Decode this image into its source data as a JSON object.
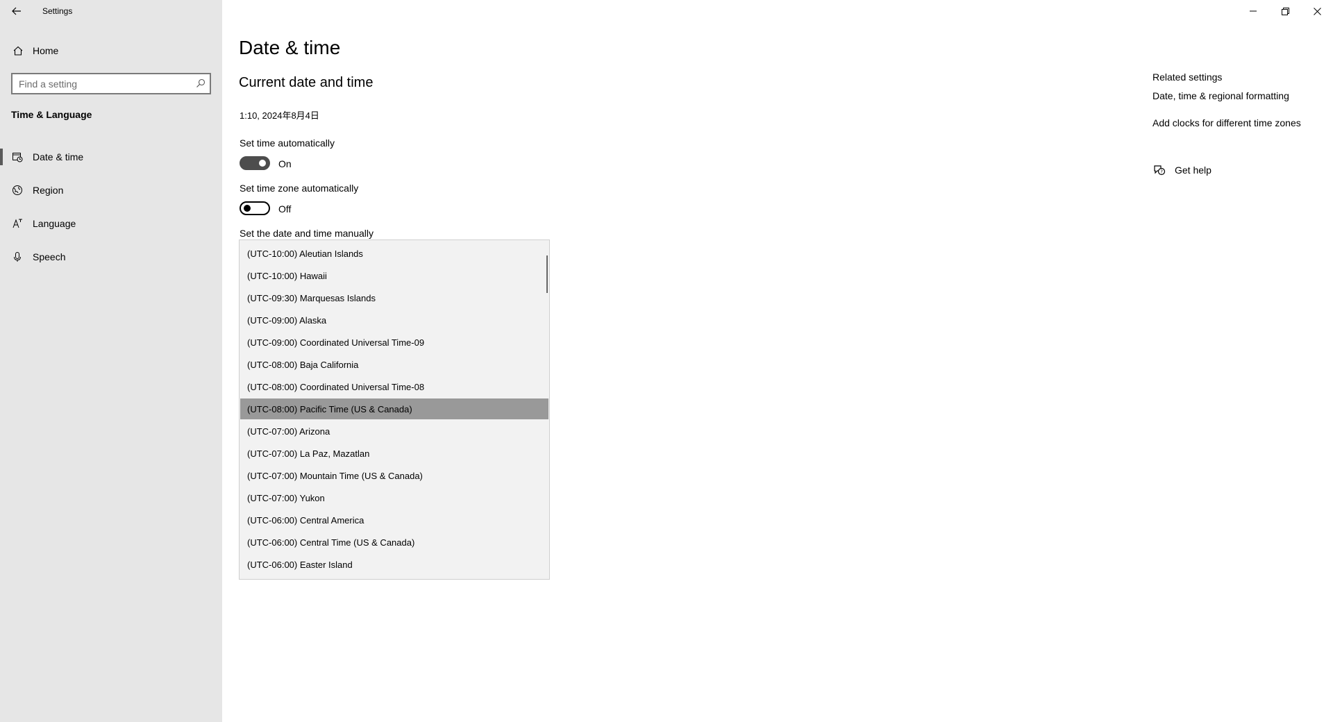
{
  "window": {
    "title": "Settings",
    "controls": [
      "minimize",
      "restore",
      "close"
    ]
  },
  "sidebar": {
    "home_label": "Home",
    "search_placeholder": "Find a setting",
    "section_title": "Time & Language",
    "items": [
      {
        "label": "Date & time",
        "icon": "calendar-clock-icon",
        "selected": true
      },
      {
        "label": "Region",
        "icon": "globe-icon",
        "selected": false
      },
      {
        "label": "Language",
        "icon": "language-icon",
        "selected": false
      },
      {
        "label": "Speech",
        "icon": "microphone-icon",
        "selected": false
      }
    ]
  },
  "main": {
    "page_title": "Date & time",
    "sub_title": "Current date and time",
    "current_time": "1:10, 2024年8月4日",
    "set_time_auto": {
      "label": "Set time automatically",
      "state": "On",
      "on": true
    },
    "set_tz_auto": {
      "label": "Set time zone automatically",
      "state": "Off",
      "on": false
    },
    "manual_label": "Set the date and time manually",
    "timezone_options": [
      "(UTC-10:00) Aleutian Islands",
      "(UTC-10:00) Hawaii",
      "(UTC-09:30) Marquesas Islands",
      "(UTC-09:00) Alaska",
      "(UTC-09:00) Coordinated Universal Time-09",
      "(UTC-08:00) Baja California",
      "(UTC-08:00) Coordinated Universal Time-08",
      "(UTC-08:00) Pacific Time (US & Canada)",
      "(UTC-07:00) Arizona",
      "(UTC-07:00) La Paz, Mazatlan",
      "(UTC-07:00) Mountain Time (US & Canada)",
      "(UTC-07:00) Yukon",
      "(UTC-06:00) Central America",
      "(UTC-06:00) Central Time (US & Canada)",
      "(UTC-06:00) Easter Island"
    ],
    "selected_timezone": "(UTC-08:00) Pacific Time (US & Canada)"
  },
  "related": {
    "title": "Related settings",
    "links": [
      "Date, time & regional formatting",
      "Add clocks for different time zones"
    ],
    "help_label": "Get help"
  },
  "colors": {
    "sidebar_bg": "#e6e6e6",
    "dropdown_bg": "#f2f2f2",
    "selected_bg": "#999999",
    "toggle_on": "#4d4d4d"
  }
}
